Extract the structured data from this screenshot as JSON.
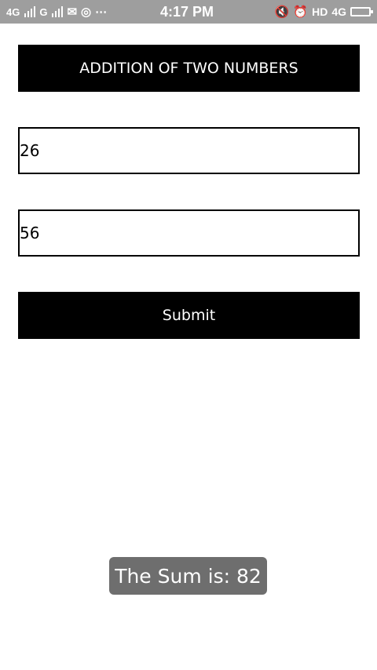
{
  "status_bar": {
    "network1": "4G",
    "network2": "G",
    "time": "4:17 PM",
    "hd_label": "HD",
    "network_right": "4G",
    "icons": [
      "signal-icon",
      "signal-icon",
      "mail-icon",
      "whatsapp-icon",
      "more-icon",
      "mute-icon",
      "alarm-icon",
      "data-arrows-icon",
      "battery-charging-icon"
    ]
  },
  "app": {
    "title": "ADDITION OF TWO NUMBERS",
    "first_number": "26",
    "second_number": "56",
    "submit_label": "Submit",
    "toast_message": "The Sum is: 82"
  },
  "colors": {
    "status_bar": "#9e9e9e",
    "primary": "#000000",
    "toast": "#6e6e6e",
    "background": "#ffffff"
  }
}
